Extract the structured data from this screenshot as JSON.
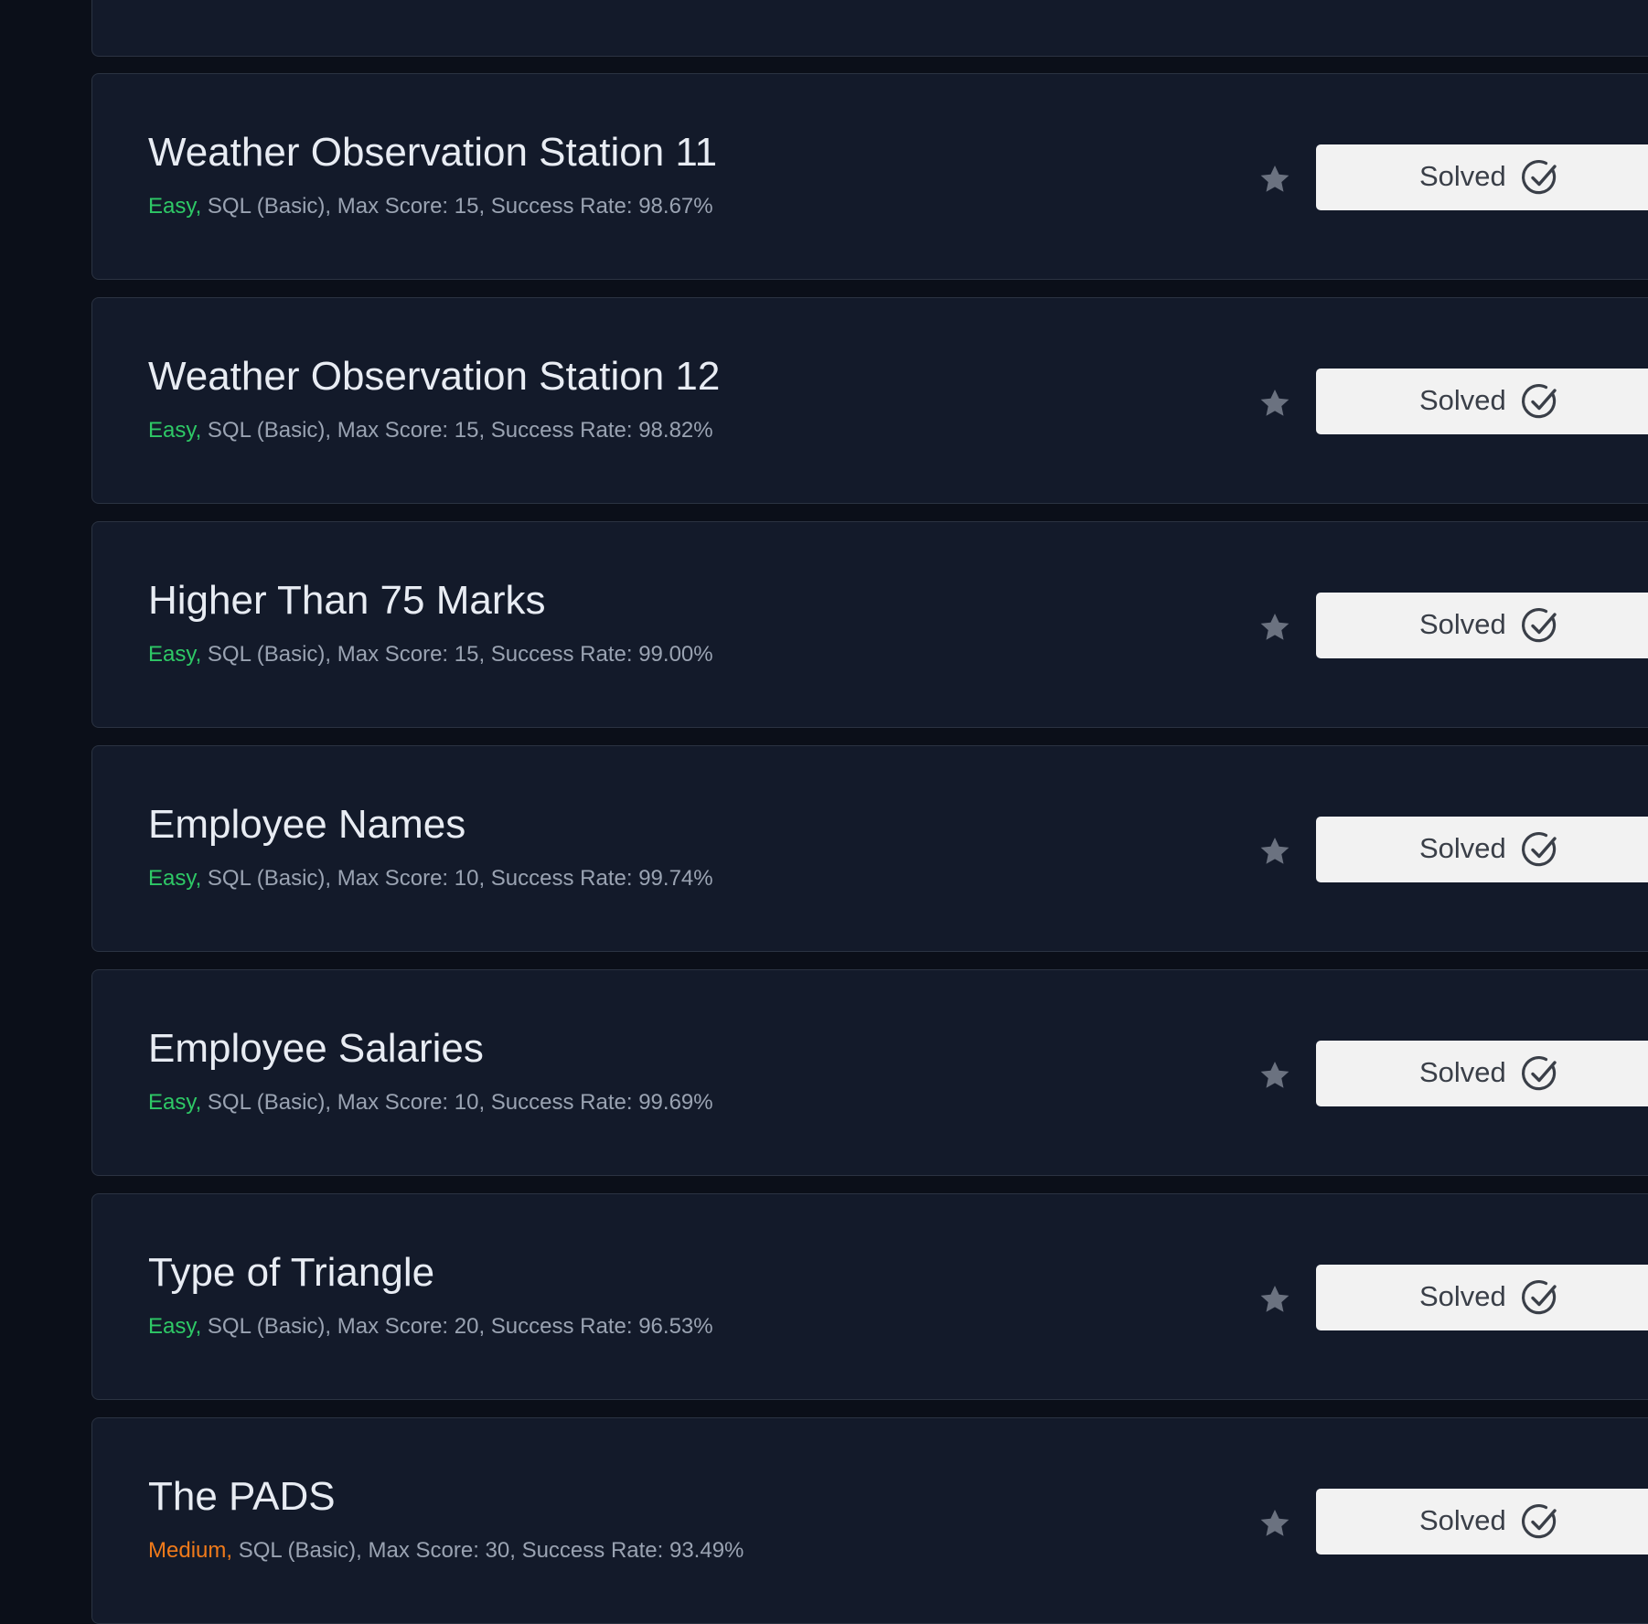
{
  "colors": {
    "page_bg": "#0b0f19",
    "card_bg": "#131a2a",
    "card_border": "#2b3342",
    "title": "#e8ecf3",
    "meta": "#9aa3b2",
    "easy": "#2ec866",
    "medium": "#f07a1a",
    "star": "#6b7280",
    "solved_bg": "#f2f2f2",
    "solved_text": "#3a3f48"
  },
  "icons": {
    "star": "star-icon",
    "check": "check-circle-icon"
  },
  "challenges": [
    {
      "title": "Weather Observation Station 11",
      "difficulty": "Easy,",
      "difficulty_level": "easy",
      "details": " SQL (Basic), Max Score: 15, Success Rate: 98.67%",
      "status": "Solved"
    },
    {
      "title": "Weather Observation Station 12",
      "difficulty": "Easy,",
      "difficulty_level": "easy",
      "details": " SQL (Basic), Max Score: 15, Success Rate: 98.82%",
      "status": "Solved"
    },
    {
      "title": "Higher Than 75 Marks",
      "difficulty": "Easy,",
      "difficulty_level": "easy",
      "details": " SQL (Basic), Max Score: 15, Success Rate: 99.00%",
      "status": "Solved"
    },
    {
      "title": "Employee Names",
      "difficulty": "Easy,",
      "difficulty_level": "easy",
      "details": " SQL (Basic), Max Score: 10, Success Rate: 99.74%",
      "status": "Solved"
    },
    {
      "title": "Employee Salaries",
      "difficulty": "Easy,",
      "difficulty_level": "easy",
      "details": " SQL (Basic), Max Score: 10, Success Rate: 99.69%",
      "status": "Solved"
    },
    {
      "title": "Type of Triangle",
      "difficulty": "Easy,",
      "difficulty_level": "easy",
      "details": " SQL (Basic), Max Score: 20, Success Rate: 96.53%",
      "status": "Solved"
    },
    {
      "title": "The PADS",
      "difficulty": "Medium,",
      "difficulty_level": "medium",
      "details": " SQL (Basic), Max Score: 30, Success Rate: 93.49%",
      "status": "Solved"
    }
  ]
}
